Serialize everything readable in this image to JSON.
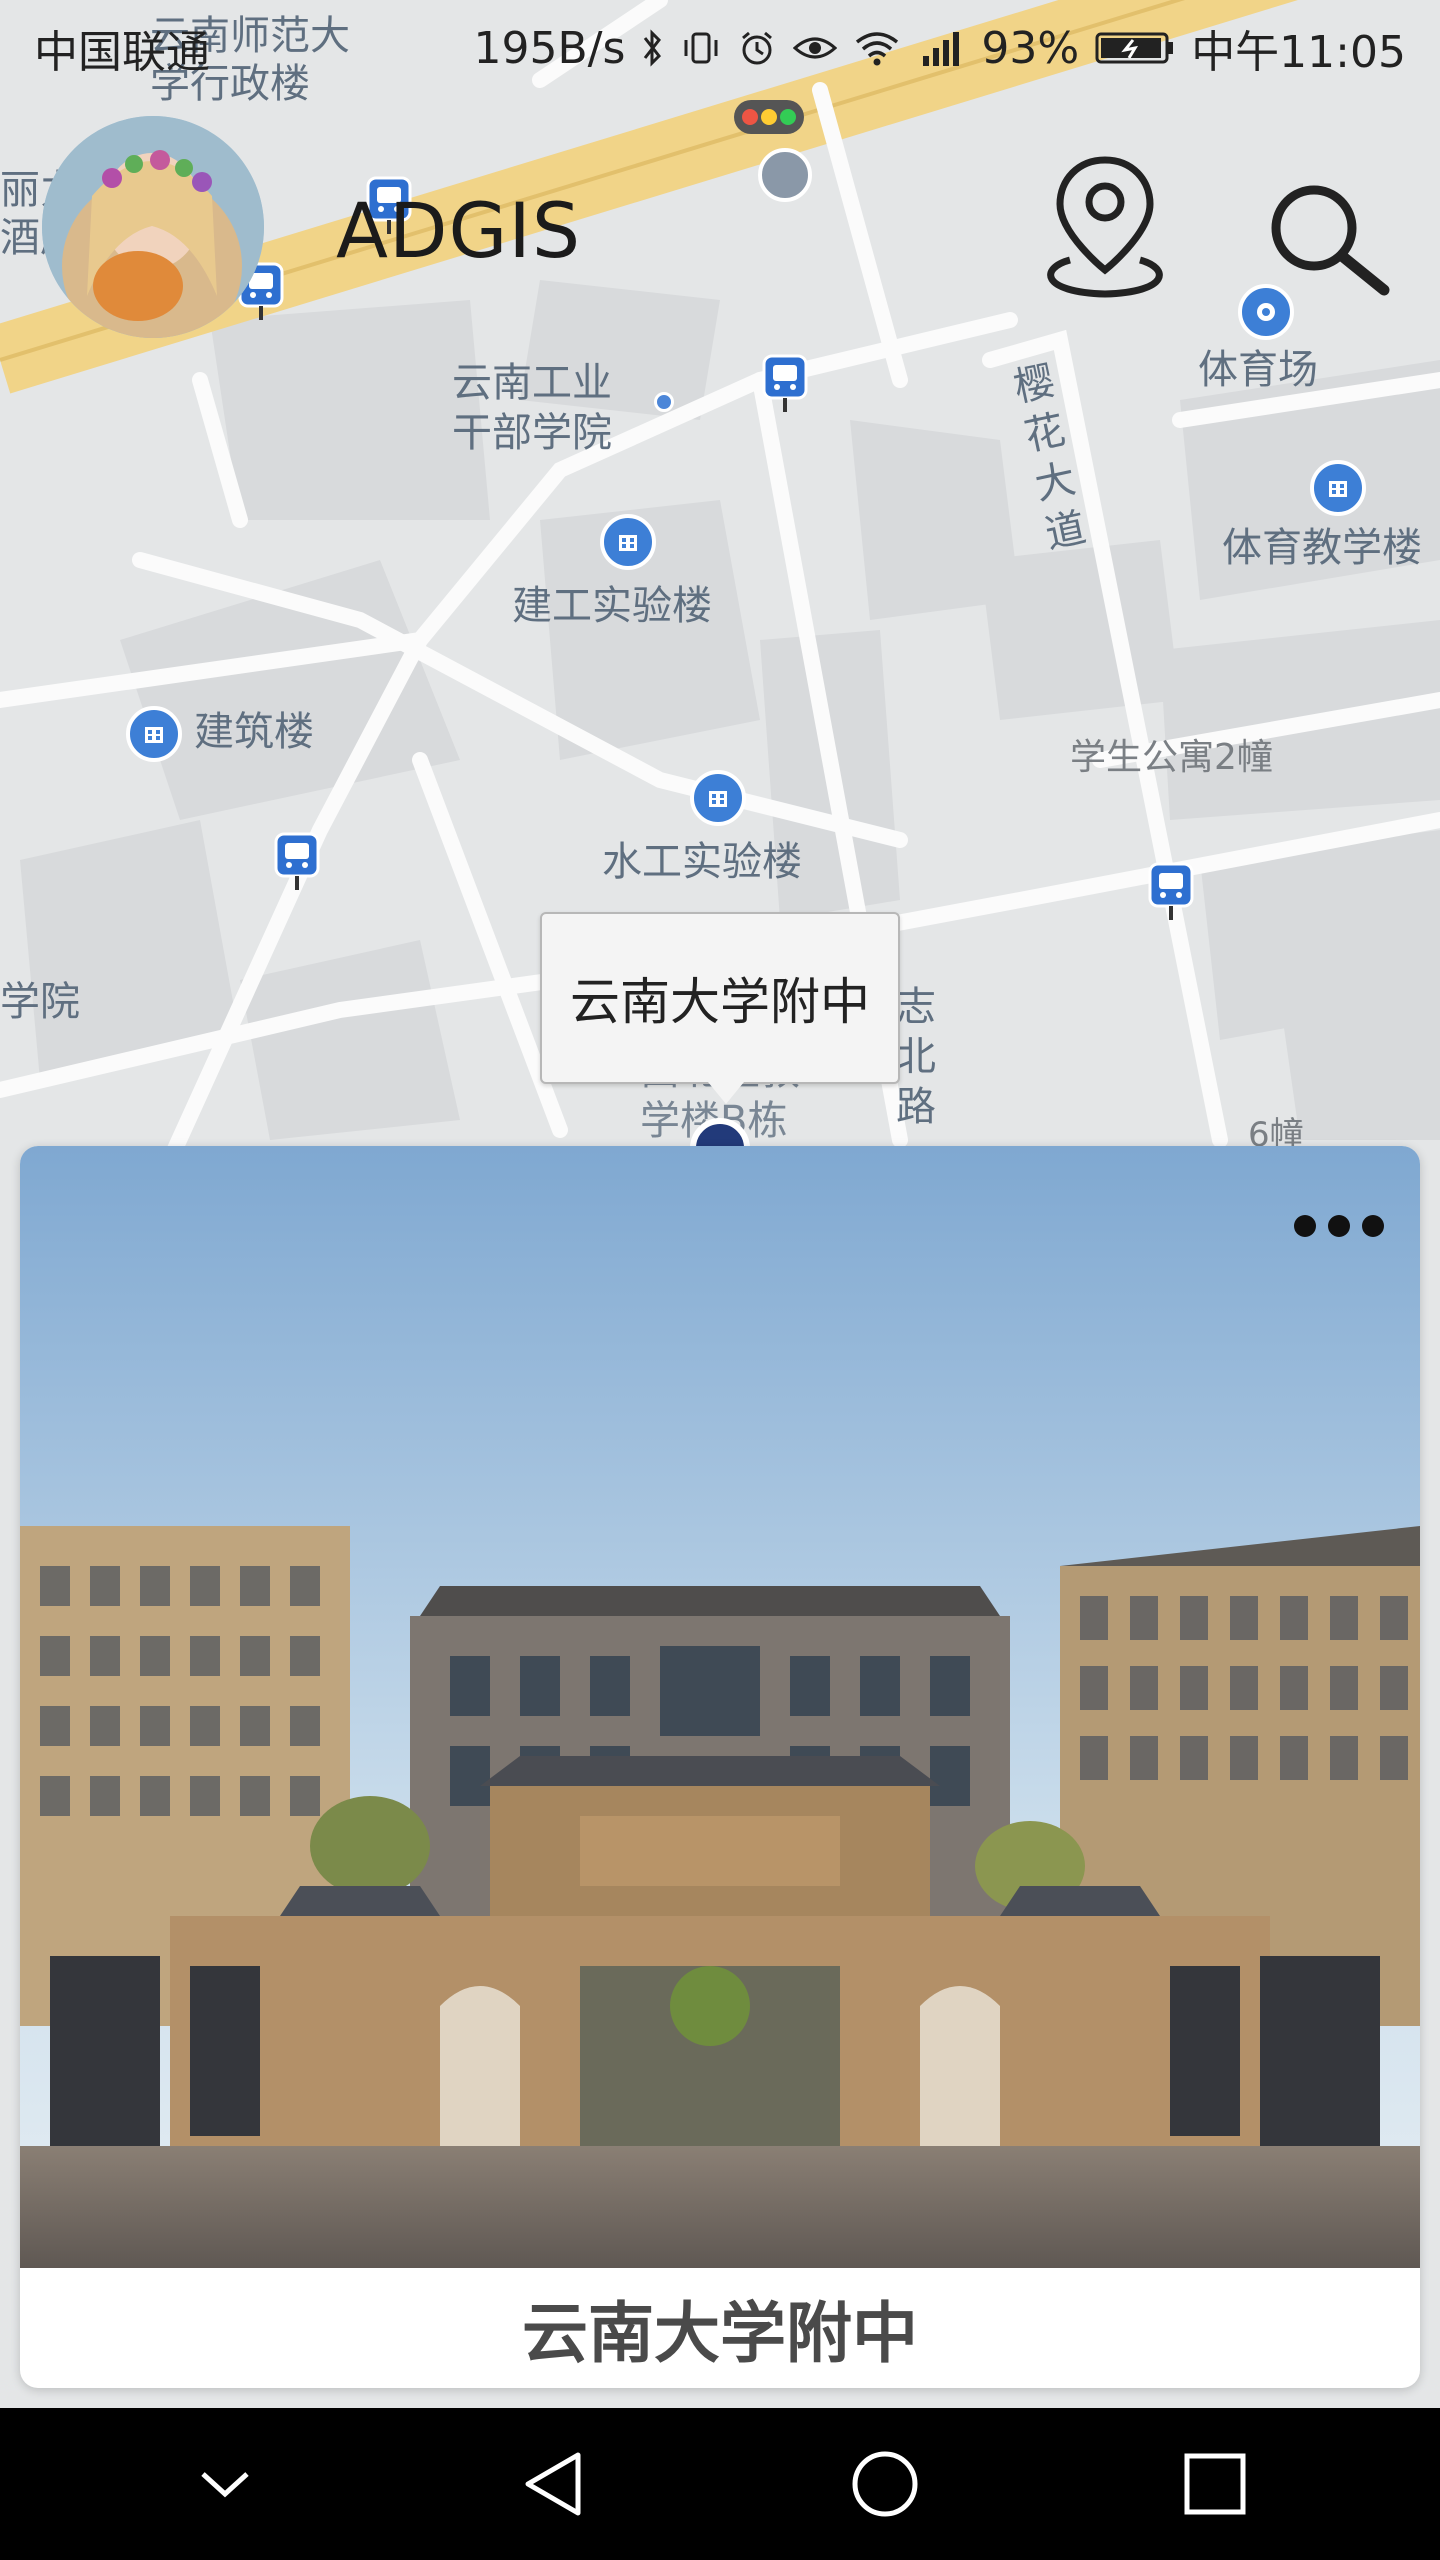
{
  "status_bar": {
    "carrier": "中国联通",
    "net_speed": "195B/s",
    "battery": "93%",
    "time": "中午11:05",
    "icons": [
      "bluetooth-icon",
      "vibrate-icon",
      "alarm-icon",
      "eye-icon",
      "wifi-icon",
      "signal-4g-icon",
      "battery-icon"
    ]
  },
  "header": {
    "app_title": "ADGIS",
    "avatar": "avatar",
    "location_icon": "location-pin-icon",
    "search_icon": "search-icon"
  },
  "map": {
    "labels": {
      "normal_admin": "云南师范大\n学行政楼",
      "industry_school": "云南工业\n干部学院",
      "stadium": "体育场",
      "sakura_road": "樱花大道",
      "pe_building": "体育教学楼",
      "construction_lab": "建工实验楼",
      "architecture": "建筑楼",
      "dorm2": "学生公寓2幢",
      "water_lab": "水工实验楼",
      "college": "学院",
      "road_v2": "志北路",
      "west_building": "西北区教\n学楼B栋",
      "building6": "6幢",
      "left_top": "丽力\n酒店"
    }
  },
  "callout": {
    "text": "云南大学附中"
  },
  "card": {
    "title": "云南大学附中",
    "more_icon": "more-dots-icon",
    "photo_desc": "school-gate-photo"
  },
  "nav_bar": {
    "icons": [
      "hide-keyboard-icon",
      "back-icon",
      "home-icon",
      "recents-icon"
    ]
  }
}
